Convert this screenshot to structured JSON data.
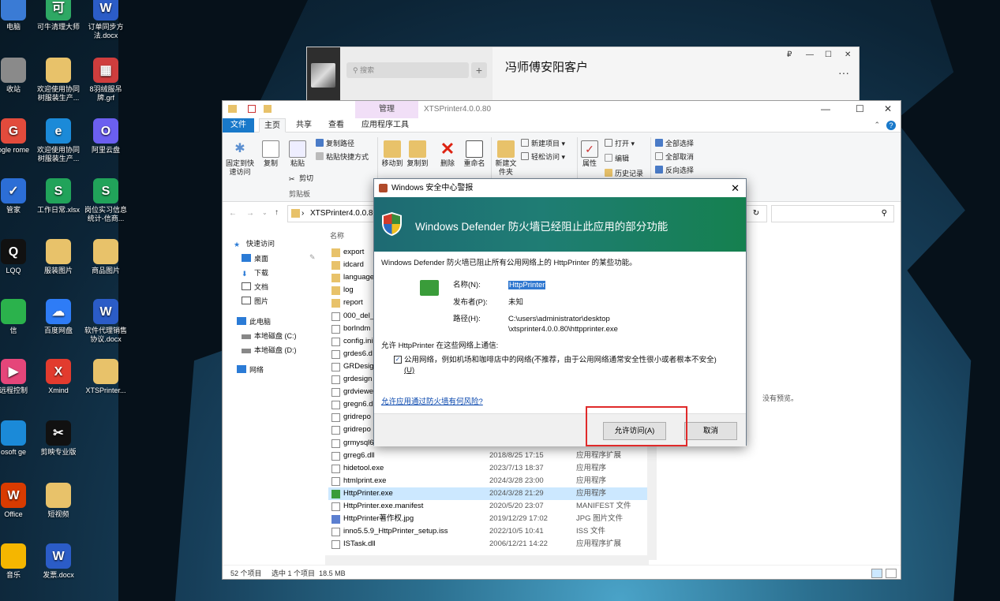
{
  "desktop": {
    "icons": [
      {
        "label": "电脑",
        "color": "#3a7bd5",
        "glyph": ""
      },
      {
        "label": "可牛清理大师",
        "color": "#2ea864",
        "glyph": "可"
      },
      {
        "label": "订单同步方法.docx",
        "color": "#2b5cc7",
        "glyph": "W"
      },
      {
        "label": "收站",
        "color": "#8a8a8a",
        "glyph": ""
      },
      {
        "label": "欢迎使用协同树服装生产...",
        "color": "#e8c26a",
        "glyph": ""
      },
      {
        "label": "8羽绒服吊牌.grf",
        "color": "#cf3d3d",
        "glyph": "▦"
      },
      {
        "label": "ogle rome",
        "color": "#e24b3c",
        "glyph": "G"
      },
      {
        "label": "欢迎使用协同树服装生产...",
        "color": "#1b8ad8",
        "glyph": "e"
      },
      {
        "label": "阿里云盘",
        "color": "#6b5ff0",
        "glyph": "O"
      },
      {
        "label": "管家",
        "color": "#2c6ed6",
        "glyph": "✓"
      },
      {
        "label": "工作日常.xlsx",
        "color": "#21a35a",
        "glyph": "S"
      },
      {
        "label": "岗位实习信息统计-信商...",
        "color": "#21a35a",
        "glyph": "S"
      },
      {
        "label": "LQQ",
        "color": "#111111",
        "glyph": "Q"
      },
      {
        "label": "服装图片",
        "color": "#e8c26a",
        "glyph": ""
      },
      {
        "label": "商品图片",
        "color": "#e8c26a",
        "glyph": ""
      },
      {
        "label": "信",
        "color": "#2bb24c",
        "glyph": ""
      },
      {
        "label": "百度网盘",
        "color": "#2e7cf6",
        "glyph": "☁"
      },
      {
        "label": "软件代理销售协议.docx",
        "color": "#2b5cc7",
        "glyph": "W"
      },
      {
        "label": "远程控制",
        "color": "#e5467a",
        "glyph": "▶"
      },
      {
        "label": "Xmind",
        "color": "#e23b2e",
        "glyph": "X"
      },
      {
        "label": "XTSPrinter...",
        "color": "#e8c26a",
        "glyph": ""
      },
      {
        "label": "osoft ge",
        "color": "#1b8ad8",
        "glyph": ""
      },
      {
        "label": "剪映专业版",
        "color": "#111111",
        "glyph": "✂"
      },
      {
        "label": "Office",
        "color": "#d83b01",
        "glyph": "W"
      },
      {
        "label": "短视频",
        "color": "#e8c26a",
        "glyph": ""
      },
      {
        "label": "音乐",
        "color": "#f5b600",
        "glyph": ""
      },
      {
        "label": "发票.docx",
        "color": "#2b5cc7",
        "glyph": "W"
      }
    ]
  },
  "wechat": {
    "search_placeholder": "搜索",
    "plus": "+",
    "chat_title": "冯师傅安阳客户",
    "pin": "₽",
    "min": "—",
    "max": "☐",
    "close": "✕",
    "more": "···"
  },
  "explorer": {
    "context_tab": "管理",
    "title": "XTSPrinter4.0.0.80",
    "tabs": [
      "文件",
      "主页",
      "共享",
      "查看",
      "应用程序工具"
    ],
    "ribbon": {
      "pin_quick": "固定到快速访问",
      "copy": "复制",
      "paste": "粘贴",
      "copy_path": "复制路径",
      "paste_shortcut": "粘贴快捷方式",
      "cut": "剪切",
      "clipboard_group": "剪贴板",
      "move_to": "移动到",
      "copy_to": "复制到",
      "delete": "删除",
      "rename": "重命名",
      "new_folder": "新建文件夹",
      "new_item": "新建项目 ▾",
      "easy_access": "轻松访问 ▾",
      "properties": "属性",
      "open": "打开 ▾",
      "edit": "编辑",
      "history": "历史记录",
      "select_all": "全部选择",
      "select_none": "全部取消",
      "invert": "反向选择"
    },
    "address": "XTSPrinter4.0.0.80",
    "nav": {
      "quick": "快速访问",
      "desktop": "桌面",
      "downloads": "下载",
      "docs": "文档",
      "pics": "图片",
      "pc": "此电脑",
      "c": "本地磁盘 (C:)",
      "d": "本地磁盘 (D:)",
      "net": "网络"
    },
    "col_name": "名称",
    "files": [
      {
        "name": "export",
        "date": "",
        "type": "",
        "kind": "folder"
      },
      {
        "name": "idcard",
        "date": "",
        "type": "",
        "kind": "folder"
      },
      {
        "name": "language",
        "date": "",
        "type": "",
        "kind": "folder"
      },
      {
        "name": "log",
        "date": "",
        "type": "",
        "kind": "folder"
      },
      {
        "name": "report",
        "date": "",
        "type": "",
        "kind": "folder"
      },
      {
        "name": "000_del_",
        "date": "",
        "type": "",
        "kind": "file"
      },
      {
        "name": "borlndm",
        "date": "",
        "type": "",
        "kind": "file"
      },
      {
        "name": "config.ini",
        "date": "",
        "type": "",
        "kind": "file"
      },
      {
        "name": "grdes6.d",
        "date": "",
        "type": "",
        "kind": "file"
      },
      {
        "name": "GRDesig",
        "date": "",
        "type": "",
        "kind": "file"
      },
      {
        "name": "grdesign",
        "date": "",
        "type": "",
        "kind": "file"
      },
      {
        "name": "grdviewe",
        "date": "",
        "type": "",
        "kind": "file"
      },
      {
        "name": "gregn6.d",
        "date": "",
        "type": "",
        "kind": "file"
      },
      {
        "name": "gridrepo",
        "date": "",
        "type": "",
        "kind": "file"
      },
      {
        "name": "gridrepo",
        "date": "",
        "type": "",
        "kind": "file"
      },
      {
        "name": "grmysql6",
        "date": "",
        "type": "",
        "kind": "file"
      },
      {
        "name": "grreg6.dll",
        "date": "2018/8/25 17:15",
        "type": "应用程序扩展",
        "kind": "file"
      },
      {
        "name": "hidetool.exe",
        "date": "2023/7/13 18:37",
        "type": "应用程序",
        "kind": "file"
      },
      {
        "name": "htmlprint.exe",
        "date": "2024/3/28 23:00",
        "type": "应用程序",
        "kind": "file"
      },
      {
        "name": "HttpPrinter.exe",
        "date": "2024/3/28 21:29",
        "type": "应用程序",
        "kind": "printer"
      },
      {
        "name": "HttpPrinter.exe.manifest",
        "date": "2020/5/20 23:07",
        "type": "MANIFEST 文件",
        "kind": "file"
      },
      {
        "name": "HttpPrinter著作权.jpg",
        "date": "2019/12/29 17:02",
        "type": "JPG 图片文件",
        "kind": "image"
      },
      {
        "name": "inno5.5.9_HttpPrinter_setup.iss",
        "date": "2022/10/5 10:41",
        "type": "ISS 文件",
        "kind": "file"
      },
      {
        "name": "ISTask.dll",
        "date": "2006/12/21 14:22",
        "type": "应用程序扩展",
        "kind": "file"
      }
    ],
    "preview_text": "没有预览。",
    "status": {
      "count": "52 个项目",
      "selected": "选中 1 个项目",
      "size": "18.5 MB"
    }
  },
  "dialog": {
    "title": "Windows 安全中心警报",
    "close": "✕",
    "heading": "Windows Defender 防火墙已经阻止此应用的部分功能",
    "intro": "Windows Defender 防火墙已阻止所有公用网络上的 HttpPrinter 的某些功能。",
    "name_label": "名称(N):",
    "name_value": "HttpPrinter",
    "publisher_label": "发布者(P):",
    "publisher_value": "未知",
    "path_label": "路径(H):",
    "path_line1": "C:\\users\\administrator\\desktop",
    "path_line2": "\\xtsprinter4.0.0.80\\httpprinter.exe",
    "allow_text": "允许 HttpPrinter 在这些网络上通信:",
    "public_line1": "公用网络，例如机场和咖啡店中的网络(不推荐，由于公用网络通常安全性很小或者根本不安全)",
    "public_line2": "(U)",
    "check": "✓",
    "risk_link": "允许应用通过防火墙有何风险?",
    "allow_button": "允许访问(A)",
    "cancel_button": "取消"
  }
}
